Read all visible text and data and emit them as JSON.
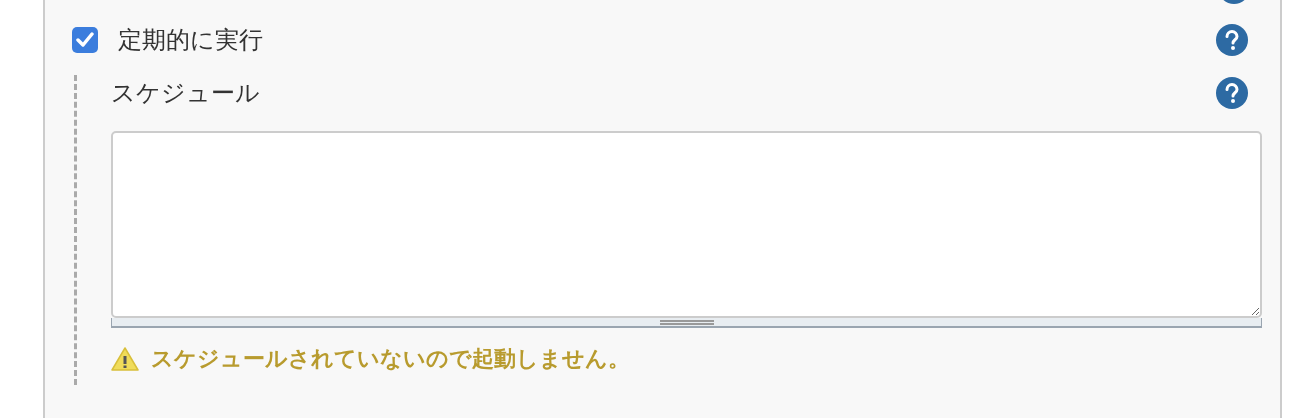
{
  "trigger": {
    "label": "定期的に実行",
    "checked": true
  },
  "schedule": {
    "label": "スケジュール"
  },
  "warning": {
    "text": "スケジュールされていないので起動しません。"
  }
}
